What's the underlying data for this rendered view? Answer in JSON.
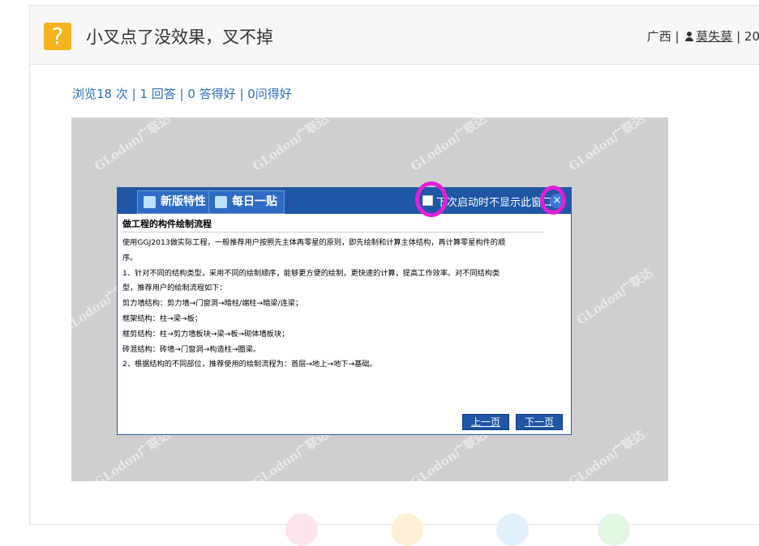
{
  "question": {
    "icon": "question-mark-icon",
    "icon_glyph": "?",
    "title": "小叉点了没效果，叉不掉",
    "region": "广西",
    "separator": " | ",
    "user_icon": "user-icon",
    "username": "莫失莫",
    "date_fragment": "20"
  },
  "stats": {
    "views": "浏览18 次",
    "answers": "1 回答",
    "good_answers": "0 答得好",
    "good_questions": "0问得好",
    "sep": " | "
  },
  "screenshot": {
    "watermark": "GLodon广联达",
    "dialog": {
      "tab_features": "新版特性",
      "tab_daily": "每日一贴",
      "dont_show_label": "下次启动时不显示此窗口",
      "close_glyph": "×",
      "content_title": "做工程的构件绘制流程",
      "lines": [
        "使用GGJ2013做实际工程，一般推荐用户按照先主体再零星的原则，即先绘制和计算主体结构，再计算零星构件的顺",
        "序。",
        "1、针对不同的结构类型，采用不同的绘制顺序，能够更方便的绘制，更快速的计算，提高工作效率。对不同结构类",
        "型，推荐用户的绘制流程如下：",
        "剪力墙结构：剪力墙→门窗洞→暗柱/端柱→暗梁/连梁；",
        "框架结构：柱→梁→板；",
        "框剪结构：柱→剪力墙板块→梁→板→砌体墙板块；",
        "砖混结构：砖墙→门窗洞→构造柱→圈梁。",
        "2、根据结构的不同部位，推荐使用的绘制流程为：首层→地上→地下→基础。"
      ],
      "prev_label": "上一页",
      "next_label": "下一页"
    }
  },
  "colors": {
    "accent_link": "#2a6ebb",
    "question_icon_bg": "#f5b31d",
    "highlight_circle": "#e020d8",
    "dialog_bar": "#1f56a6"
  }
}
